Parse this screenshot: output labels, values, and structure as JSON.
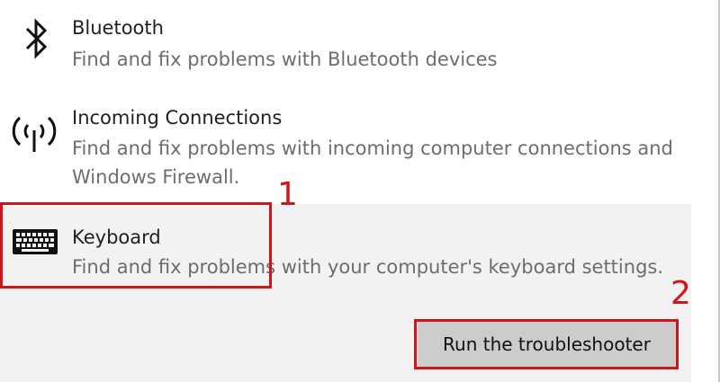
{
  "items": [
    {
      "icon": "bluetooth-icon",
      "title": "Bluetooth",
      "description_lines": [
        "Find and fix problems with Bluetooth devices"
      ]
    },
    {
      "icon": "incoming-connections-icon",
      "title": "Incoming Connections",
      "description_lines": [
        "Find and fix problems with incoming computer connections and",
        "Windows Firewall."
      ]
    },
    {
      "icon": "keyboard-icon",
      "title": "Keyboard",
      "description_lines": [
        "Find and fix problems with your computer's keyboard settings."
      ],
      "selected": true,
      "button_label": "Run the troubleshooter"
    }
  ],
  "annotations": {
    "step1_label": "1",
    "step2_label": "2",
    "color": "#d0141b"
  },
  "colors": {
    "selected_background": "#f2f2f2",
    "button_background": "#cccccc",
    "description_text": "#6d6d6d"
  }
}
